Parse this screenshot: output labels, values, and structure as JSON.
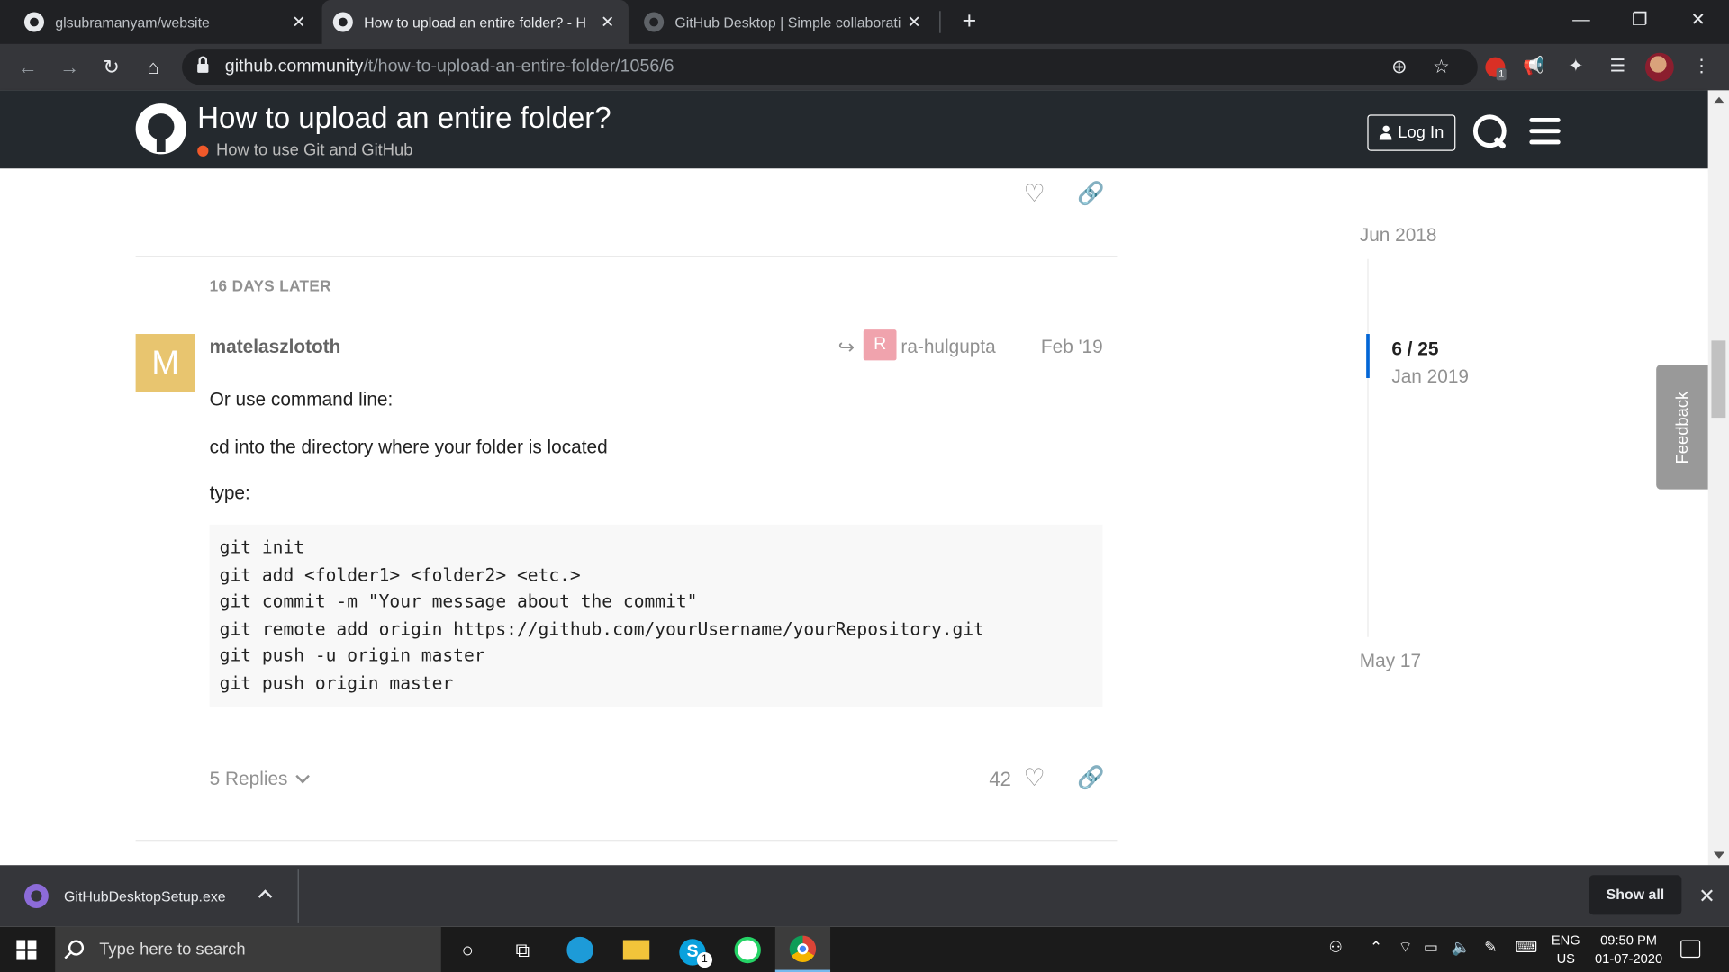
{
  "browser": {
    "tabs": [
      {
        "title": "glsubramanyam/website",
        "active": false
      },
      {
        "title": "How to upload an entire folder? - H",
        "active": true
      },
      {
        "title": "GitHub Desktop | Simple collaborati",
        "active": false
      }
    ],
    "url_domain": "github.community",
    "url_path": "/t/how-to-upload-an-entire-folder/1056/6",
    "extension_badge": "1"
  },
  "header": {
    "title": "How to upload an entire folder?",
    "category": "How to use Git and GitHub",
    "category_color": "#f1592a",
    "login_label": "Log In"
  },
  "post": {
    "time_gap": "16 DAYS LATER",
    "avatar_letter": "M",
    "avatar_color": "#e8c56f",
    "username": "matelaszlototh",
    "reply_to_letter": "R",
    "reply_to": "ra-hulgupta",
    "date": "Feb '19",
    "paragraphs": [
      "Or use command line:",
      "cd into the directory where your folder is located",
      "type:"
    ],
    "code": [
      "git init",
      "git add <folder1> <folder2> <etc.>",
      "git commit -m \"Your message about the commit\"",
      "git remote add origin https://github.com/yourUsername/yourRepository.git",
      "git push -u origin master",
      "git push origin master"
    ],
    "replies_label": "5 Replies",
    "likes": "42"
  },
  "timeline": {
    "start": "Jun 2018",
    "position": "6 / 25",
    "position_date": "Jan 2019",
    "end": "May 17"
  },
  "feedback_label": "Feedback",
  "downloads": {
    "file": "GitHubDesktopSetup.exe",
    "show_all": "Show all"
  },
  "taskbar": {
    "search_placeholder": "Type here to search",
    "skype_badge": "1",
    "lang_line1": "ENG",
    "lang_line2": "US",
    "time": "09:50 PM",
    "date": "01-07-2020"
  }
}
